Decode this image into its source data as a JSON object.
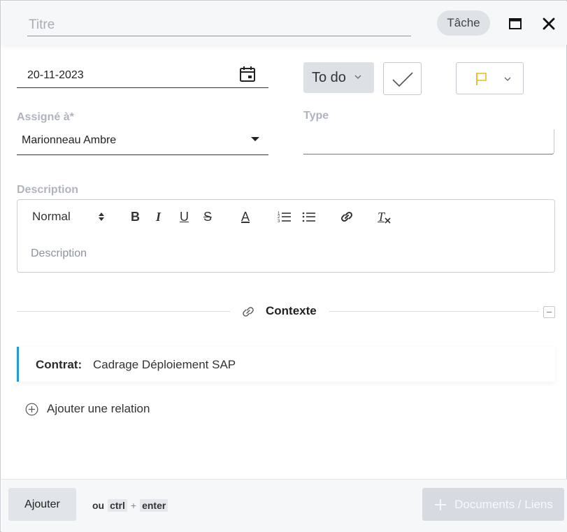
{
  "header": {
    "title_placeholder": "Titre",
    "title_value": "",
    "type_badge": "Tâche"
  },
  "date": {
    "value": "20-11-2023"
  },
  "status": {
    "value": "To do"
  },
  "assigned": {
    "label": "Assigné à*",
    "value": "Marionneau Ambre"
  },
  "type": {
    "label": "Type",
    "value": ""
  },
  "description": {
    "label": "Description",
    "heading_option": "Normal",
    "placeholder": "Description",
    "toolbar": {
      "bold": "B",
      "italic": "I",
      "underline": "U",
      "strike": "S",
      "font_color": "A",
      "clear_format": "T"
    }
  },
  "contexte": {
    "title": "Contexte",
    "contract_label": "Contrat:",
    "contract_value": "Cadrage Déploiement SAP",
    "add_relation": "Ajouter une relation"
  },
  "footer": {
    "add_button": "Ajouter",
    "hint_or": "ou",
    "hint_key1": "ctrl",
    "hint_plus": "+",
    "hint_key2": "enter",
    "docs_button": "Documents / Liens"
  },
  "colors": {
    "accent_line": "#1f9bd7",
    "flag": "#f2b81c",
    "title_underline": "#8c93c9"
  }
}
